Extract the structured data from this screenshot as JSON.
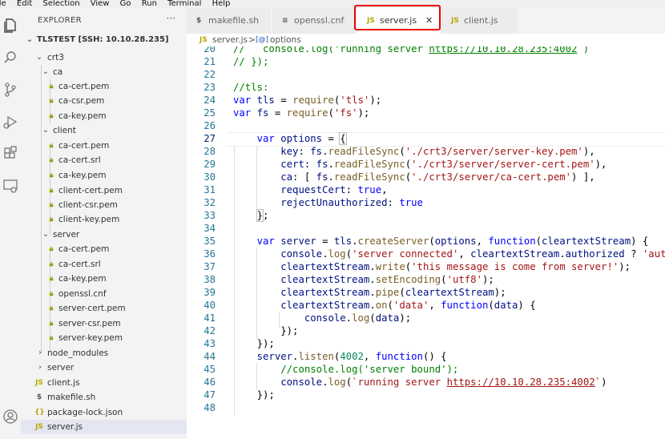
{
  "menu": [
    "ile",
    "Edit",
    "Selection",
    "View",
    "Go",
    "Run",
    "Terminal",
    "Help"
  ],
  "activity_icons": [
    "files-icon",
    "search-icon",
    "source-control-icon",
    "run-debug-icon",
    "extensions-icon",
    "remote-explorer-icon",
    "account-icon"
  ],
  "sidebar": {
    "title": "EXPLORER",
    "more": "···",
    "root": "TLSTEST [SSH: 10.10.28.235]",
    "items": [
      {
        "label": "crt3",
        "type": "folder"
      },
      {
        "label": "ca",
        "type": "folder"
      },
      {
        "label": "ca-cert.pem",
        "type": "pem"
      },
      {
        "label": "ca-csr.pem",
        "type": "pem"
      },
      {
        "label": "ca-key.pem",
        "type": "pem"
      },
      {
        "label": "client",
        "type": "folder"
      },
      {
        "label": "ca-cert.pem",
        "type": "pem"
      },
      {
        "label": "ca-cert.srl",
        "type": "pem"
      },
      {
        "label": "ca-key.pem",
        "type": "pem"
      },
      {
        "label": "client-cert.pem",
        "type": "pem"
      },
      {
        "label": "client-csr.pem",
        "type": "pem"
      },
      {
        "label": "client-key.pem",
        "type": "pem"
      },
      {
        "label": "server",
        "type": "folder"
      },
      {
        "label": "ca-cert.pem",
        "type": "pem"
      },
      {
        "label": "ca-cert.srl",
        "type": "pem"
      },
      {
        "label": "ca-key.pem",
        "type": "pem"
      },
      {
        "label": "openssl.cnf",
        "type": "pem"
      },
      {
        "label": "server-cert.pem",
        "type": "pem"
      },
      {
        "label": "server-csr.pem",
        "type": "pem"
      },
      {
        "label": "server-key.pem",
        "type": "pem"
      },
      {
        "label": "node_modules",
        "type": "folder-closed"
      },
      {
        "label": "server",
        "type": "folder-closed"
      },
      {
        "label": "client.js",
        "type": "js",
        "icon": "JS"
      },
      {
        "label": "makefile.sh",
        "type": "sh",
        "icon": "$"
      },
      {
        "label": "package-lock.json",
        "type": "json",
        "icon": "{}"
      },
      {
        "label": "server.js",
        "type": "js",
        "icon": "JS"
      }
    ]
  },
  "tabs": [
    {
      "label": "makefile.sh",
      "icon": "$"
    },
    {
      "label": "openssl.cnf",
      "icon": "≡"
    },
    {
      "label": "server.js",
      "icon": "JS",
      "close": "✕"
    },
    {
      "label": "client.js",
      "icon": "JS"
    }
  ],
  "breadcrumb": {
    "icon": "JS",
    "file": "server.js",
    "sep": ">",
    "symbol_icon": "[@]",
    "symbol": "options"
  },
  "editor": {
    "line_numbers": [
      "20",
      "21",
      "22",
      "23",
      "24",
      "25",
      "26",
      "27",
      "28",
      "29",
      "30",
      "31",
      "32",
      "33",
      "34",
      "35",
      "36",
      "37",
      "38",
      "39",
      "40",
      "41",
      "42",
      "43",
      "44",
      "45",
      "46",
      "47",
      "48"
    ],
    "current_line": "27"
  }
}
